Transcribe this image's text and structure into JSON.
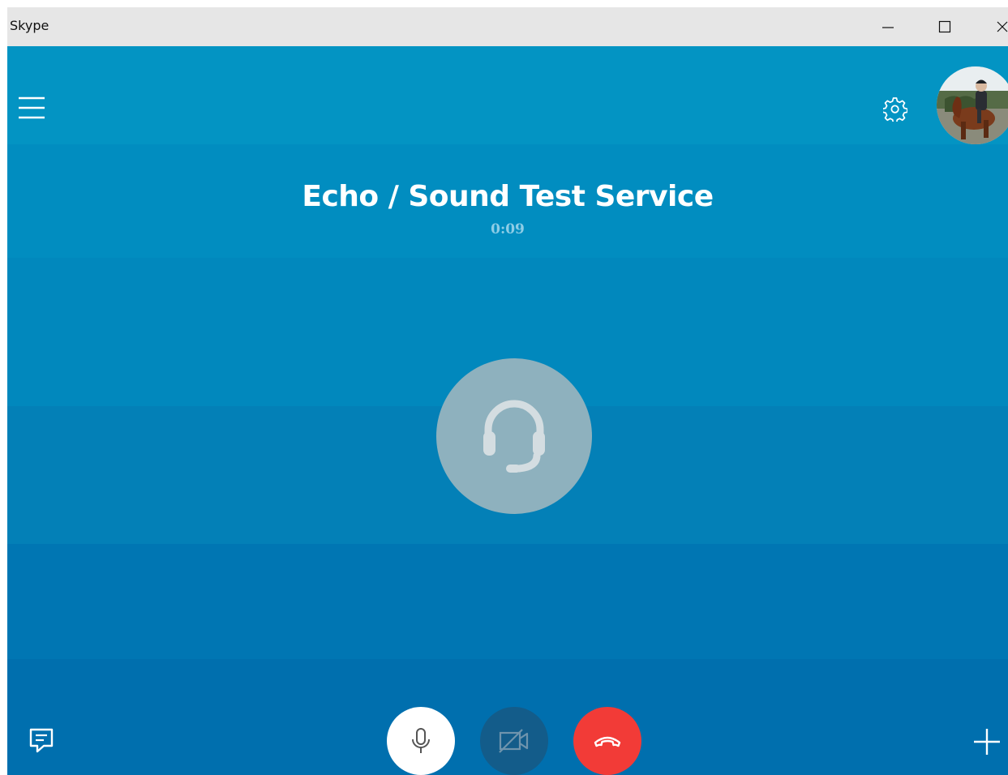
{
  "window": {
    "title": "Skype",
    "minimize_icon": "minimize-icon",
    "maximize_icon": "maximize-icon",
    "close_icon": "close-icon"
  },
  "colors": {
    "titlebar": "#e6e6e6",
    "band_1": "#0394c3",
    "band_2": "#018dc0",
    "band_3": "#0188bd",
    "band_4": "#0380b7",
    "band_5": "#0076b3",
    "band_6": "#006fae",
    "contact_circle": "#8eb1be",
    "contact_glyph": "#d4dde1",
    "timer": "#8ecde6",
    "mic_bg": "#ffffff",
    "mic_glyph": "#555555",
    "video_bg": "#135c8a",
    "video_glyph": "#6f94ad",
    "hangup_bg": "#f23b37",
    "white": "#ffffff"
  },
  "header": {
    "menu_icon": "hamburger-menu-icon",
    "settings_icon": "gear-icon",
    "avatar": "profile-avatar"
  },
  "call": {
    "contact_name": "Echo / Sound Test Service",
    "duration": "0:09",
    "contact_icon": "headset-icon"
  },
  "controls": {
    "chat_icon": "chat-icon",
    "mic_icon": "microphone-icon",
    "video_icon": "video-off-icon",
    "hangup_icon": "hang-up-icon",
    "add_icon": "plus-icon"
  }
}
